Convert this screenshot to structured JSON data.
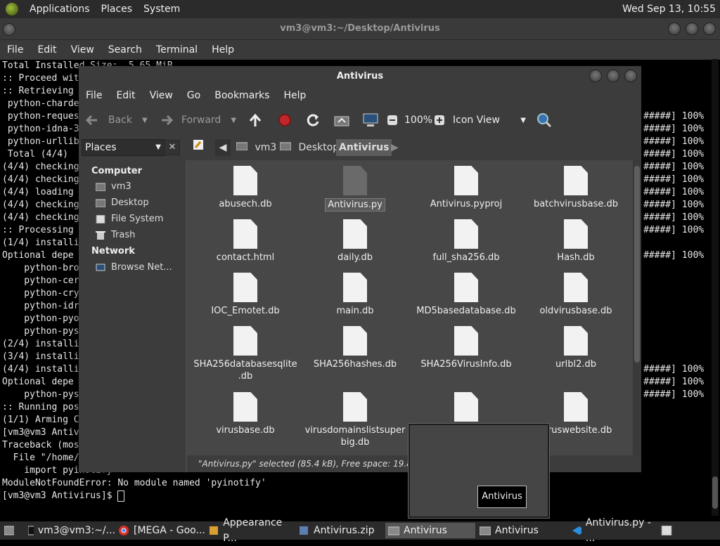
{
  "top_panel": {
    "menus": [
      "Applications",
      "Places",
      "System"
    ],
    "clock": "Wed Sep 13, 10:55"
  },
  "terminal": {
    "title": "vm3@vm3:~/Desktop/Antivirus",
    "menus": [
      "File",
      "Edit",
      "View",
      "Search",
      "Terminal",
      "Help"
    ],
    "lines": [
      "Total Installed Size:  5.65 MiB",
      "",
      ":: Proceed wit",
      ":: Retrieving",
      " python-charde",
      " python-reques",
      " python-idna-3",
      " python-urllib",
      " Total (4/4)",
      "(4/4) checking",
      "(4/4) checking",
      "(4/4) loading",
      "(4/4) checking",
      "(4/4) checking",
      ":: Processing",
      "(1/4) installi",
      "Optional depe",
      "    python-bro",
      "    python-cer",
      "    python-cry",
      "    python-idr",
      "    python-pyo",
      "    python-pys",
      "(2/4) installi",
      "(3/4) installi",
      "(4/4) installi",
      "Optional depe",
      "    python-pys",
      ":: Running pos",
      "(1/1) Arming C",
      "[vm3@vm3 Antiv",
      "Traceback (mos",
      "  File \"/home/",
      "    import pyinotify",
      "ModuleNotFoundError: No module named 'pyinotify'",
      "[vm3@vm3 Antivirus]$ "
    ],
    "right_lines": [
      "#####] 100%",
      "#####] 100%",
      "#####] 100%",
      "#####] 100%",
      "#####] 100%",
      "#####] 100%",
      "#####] 100%",
      "#####] 100%",
      "#####] 100%",
      "#####] 100%",
      "",
      "#####] 100%",
      "",
      "",
      "",
      "",
      "",
      "",
      "",
      "",
      "#####] 100%",
      "#####] 100%",
      "#####] 100%"
    ]
  },
  "file_manager": {
    "title": "Antivirus",
    "menus": [
      "File",
      "Edit",
      "View",
      "Go",
      "Bookmarks",
      "Help"
    ],
    "toolbar": {
      "back": "Back",
      "forward": "Forward",
      "zoom": "100%",
      "view_mode": "Icon View"
    },
    "places_label": "Places",
    "breadcrumb": [
      "vm3",
      "Desktop",
      "Antivirus"
    ],
    "sidebar": {
      "computer_heading": "Computer",
      "computer_items": [
        "vm3",
        "Desktop",
        "File System",
        "Trash"
      ],
      "network_heading": "Network",
      "network_items": [
        "Browse Net..."
      ]
    },
    "files": [
      {
        "name": "abusech.db"
      },
      {
        "name": "Antivirus.py",
        "selected": true
      },
      {
        "name": "Antivirus.pyproj"
      },
      {
        "name": "batchvirusbase.db"
      },
      {
        "name": "contact.html"
      },
      {
        "name": "daily.db"
      },
      {
        "name": "full_sha256.db"
      },
      {
        "name": "Hash.db"
      },
      {
        "name": "IOC_Emotet.db"
      },
      {
        "name": "main.db"
      },
      {
        "name": "MD5basedatabase.db"
      },
      {
        "name": "oldvirusbase.db"
      },
      {
        "name": "SHA256databasesqlite\n.db"
      },
      {
        "name": "SHA256hashes.db"
      },
      {
        "name": "SHA256VirusInfo.db"
      },
      {
        "name": "urlbl2.db"
      },
      {
        "name": "virusbase.db"
      },
      {
        "name": "virusdomainslistsuper\nbig.db"
      },
      {
        "name": ""
      },
      {
        "name": "viruswebsite.db"
      }
    ],
    "status": "\"Antivirus.py\" selected (85.4 kB), Free space: 19.8 GB"
  },
  "preview": {
    "label": "Antivirus"
  },
  "taskbar": {
    "tasks": [
      {
        "label": "vm3@vm3:~/..."
      },
      {
        "label": "[MEGA - Goo..."
      },
      {
        "label": "Appearance P..."
      },
      {
        "label": "Antivirus.zip"
      },
      {
        "label": "Antivirus",
        "active": true
      },
      {
        "label": "Antivirus"
      },
      {
        "label": "Antivirus.py - ..."
      }
    ]
  }
}
